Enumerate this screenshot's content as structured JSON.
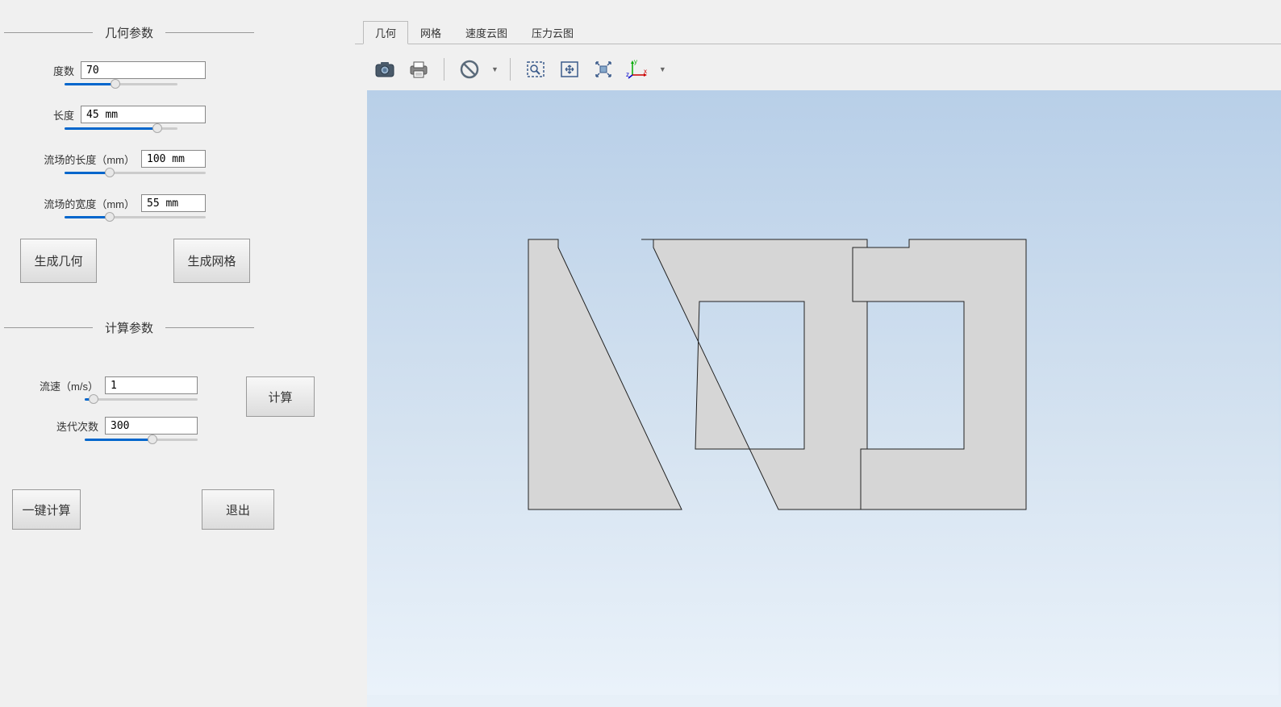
{
  "sections": {
    "geometry": {
      "title": "几何参数"
    },
    "compute": {
      "title": "计算参数"
    }
  },
  "params": {
    "degree": {
      "label": "度数",
      "value": "70",
      "slider_pct": 45
    },
    "length": {
      "label": "长度",
      "value": "45 mm",
      "slider_pct": 82
    },
    "flow_length": {
      "label": "流场的长度（mm）",
      "value": "100 mm",
      "slider_pct": 32
    },
    "flow_width": {
      "label": "流场的宽度（mm）",
      "value": "55 mm",
      "slider_pct": 32
    },
    "velocity": {
      "label": "流速（m/s）",
      "value": "1",
      "slider_pct": 8
    },
    "iterations": {
      "label": "迭代次数",
      "value": "300",
      "slider_pct": 60
    }
  },
  "buttons": {
    "gen_geometry": "生成几何",
    "gen_mesh": "生成网格",
    "compute": "计算",
    "one_click": "一键计算",
    "exit": "退出"
  },
  "tabs": {
    "geometry": "几何",
    "mesh": "网格",
    "velocity_cloud": "速度云图",
    "pressure_cloud": "压力云图"
  },
  "axis": {
    "x": "x",
    "y": "y",
    "z": "z"
  }
}
